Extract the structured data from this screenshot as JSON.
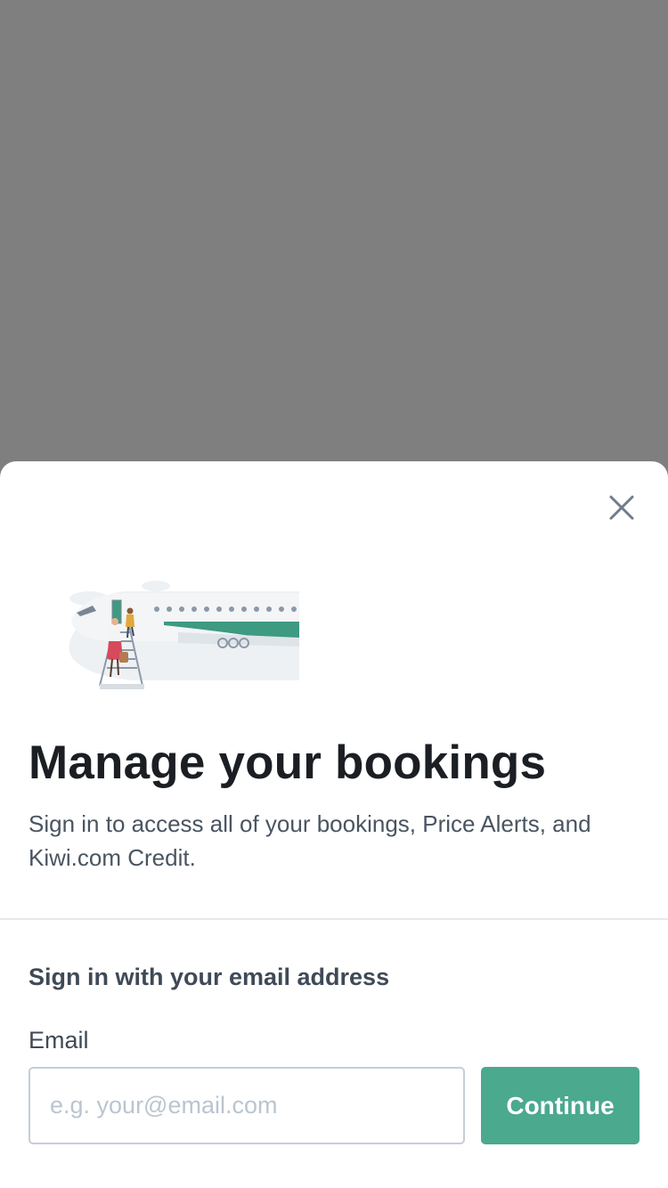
{
  "modal": {
    "close_icon": "close-icon",
    "illustration": "airplane-boarding-illustration",
    "title": "Manage your bookings",
    "subtitle": "Sign in to access all of your bookings, Price Alerts, and Kiwi.com Credit."
  },
  "signin": {
    "section_title": "Sign in with your email address",
    "email_label": "Email",
    "email_value": "",
    "email_placeholder": "e.g. your@email.com",
    "continue_label": "Continue"
  },
  "colors": {
    "backdrop": "#7f7f7f",
    "accent": "#4ba98e",
    "text_dark": "#1b1f23",
    "text_muted": "#4a5562"
  }
}
